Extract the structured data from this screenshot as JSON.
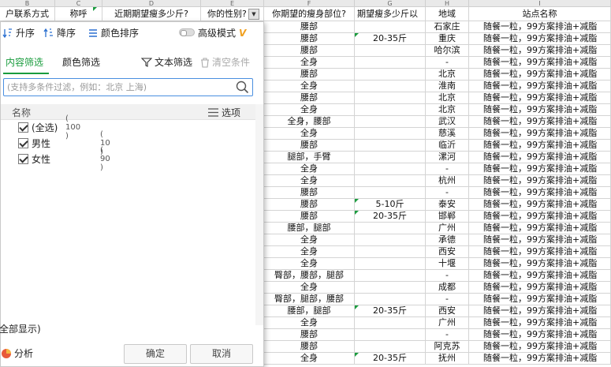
{
  "sheet": {
    "column_letters": [
      "B",
      "C",
      "D",
      "E",
      "F",
      "G",
      "H",
      "I"
    ],
    "headers": [
      "户联系方式",
      "称呼",
      "近期期望瘦多少斤?",
      "你的性别?",
      "你期望的瘦身部位?",
      "期望瘦多少斤以",
      "地域",
      "站点名称"
    ],
    "rows": [
      {
        "part": "腰部",
        "kg": "",
        "region": "石家庄",
        "site": "随餐一粒，99方案排油+减脂"
      },
      {
        "part": "腰部",
        "kg": "20-35斤",
        "region": "重庆",
        "site": "随餐一粒，99方案排油+减脂"
      },
      {
        "part": "腰部",
        "kg": "",
        "region": "哈尔滨",
        "site": "随餐一粒，99方案排油+减脂"
      },
      {
        "part": "全身",
        "kg": "",
        "region": "-",
        "site": "随餐一粒，99方案排油+减脂"
      },
      {
        "part": "腰部",
        "kg": "",
        "region": "北京",
        "site": "随餐一粒，99方案排油+减脂"
      },
      {
        "part": "全身",
        "kg": "",
        "region": "淮南",
        "site": "随餐一粒，99方案排油+减脂"
      },
      {
        "part": "腰部",
        "kg": "",
        "region": "北京",
        "site": "随餐一粒，99方案排油+减脂"
      },
      {
        "part": "全身",
        "kg": "",
        "region": "北京",
        "site": "随餐一粒，99方案排油+减脂"
      },
      {
        "part": "全身，腰部",
        "kg": "",
        "region": "武汉",
        "site": "随餐一粒，99方案排油+减脂"
      },
      {
        "part": "全身",
        "kg": "",
        "region": "慈溪",
        "site": "随餐一粒，99方案排油+减脂"
      },
      {
        "part": "腰部",
        "kg": "",
        "region": "临沂",
        "site": "随餐一粒，99方案排油+减脂"
      },
      {
        "part": "腿部，手臂",
        "kg": "",
        "region": "漯河",
        "site": "随餐一粒，99方案排油+减脂"
      },
      {
        "part": "全身",
        "kg": "",
        "region": "-",
        "site": "随餐一粒，99方案排油+减脂"
      },
      {
        "part": "全身",
        "kg": "",
        "region": "杭州",
        "site": "随餐一粒，99方案排油+减脂"
      },
      {
        "part": "腰部",
        "kg": "",
        "region": "-",
        "site": "随餐一粒，99方案排油+减脂"
      },
      {
        "part": "腰部",
        "kg": "5-10斤",
        "region": "泰安",
        "site": "随餐一粒，99方案排油+减脂"
      },
      {
        "part": "腰部",
        "kg": "20-35斤",
        "region": "邯郸",
        "site": "随餐一粒，99方案排油+减脂"
      },
      {
        "part": "腰部，腿部",
        "kg": "",
        "region": "广州",
        "site": "随餐一粒，99方案排油+减脂"
      },
      {
        "part": "全身",
        "kg": "",
        "region": "承德",
        "site": "随餐一粒，99方案排油+减脂"
      },
      {
        "part": "全身",
        "kg": "",
        "region": "西安",
        "site": "随餐一粒，99方案排油+减脂"
      },
      {
        "part": "全身",
        "kg": "",
        "region": "十堰",
        "site": "随餐一粒，99方案排油+减脂"
      },
      {
        "part": "臀部，腰部，腿部",
        "kg": "",
        "region": "-",
        "site": "随餐一粒，99方案排油+减脂"
      },
      {
        "part": "全身",
        "kg": "",
        "region": "成都",
        "site": "随餐一粒，99方案排油+减脂"
      },
      {
        "part": "臀部，腿部，腰部",
        "kg": "",
        "region": "-",
        "site": "随餐一粒，99方案排油+减脂"
      },
      {
        "part": "腰部，腿部",
        "kg": "20-35斤",
        "region": "西安",
        "site": "随餐一粒，99方案排油+减脂"
      },
      {
        "part": "全身",
        "kg": "",
        "region": "广州",
        "site": "随餐一粒，99方案排油+减脂"
      },
      {
        "part": "腰部",
        "kg": "",
        "region": "-",
        "site": "随餐一粒，99方案排油+减脂"
      },
      {
        "part": "腰部",
        "kg": "",
        "region": "阿克苏",
        "site": "随餐一粒，99方案排油+减脂"
      },
      {
        "part": "全身",
        "kg": "20-35斤",
        "region": "抚州",
        "site": "随餐一粒，99方案排油+减脂"
      }
    ]
  },
  "panel": {
    "sort_asc": "升序",
    "sort_desc": "降序",
    "sort_color": "颜色排序",
    "advanced_mode": "高级模式",
    "tab_content": "内容筛选",
    "tab_color": "颜色筛选",
    "text_filter": "文本筛选",
    "clear_conditions": "清空条件",
    "search_placeholder": "(支持多条件过滤，例如：北京 上海)",
    "list_header": "名称",
    "options": "选项",
    "items": [
      {
        "label": "(全选)",
        "count": "( 100 )"
      },
      {
        "label": "男性",
        "count": "( 10 )"
      },
      {
        "label": "女性",
        "count": "( 90 )"
      }
    ],
    "show_all": "全部显示)",
    "analysis": "分析",
    "ok": "确定",
    "cancel": "取消"
  },
  "colors": {
    "accent": "#1a9c3e",
    "vip": "#f0a020",
    "search_border": "#4a8fe0"
  }
}
